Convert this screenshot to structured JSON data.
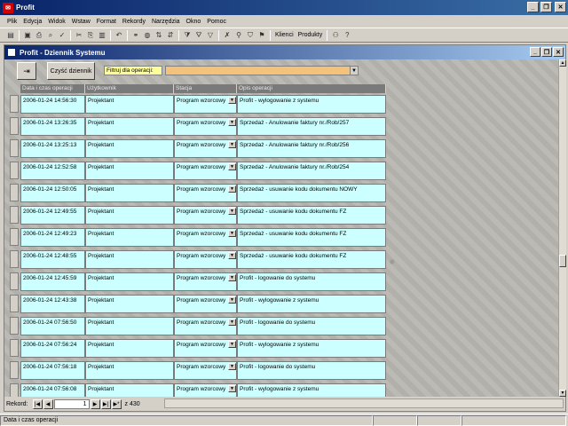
{
  "app": {
    "title": "Profit"
  },
  "menu": [
    "Plik",
    "Edycja",
    "Widok",
    "Wstaw",
    "Format",
    "Rekordy",
    "Narzędzia",
    "Okno",
    "Pomoc"
  ],
  "toolbar": {
    "clients_label": "Klienci",
    "products_label": "Produkty"
  },
  "window": {
    "title": "Profit - Dziennik Systemu"
  },
  "form": {
    "clear_button": "Czyść dziennik",
    "filter_label": "Filtruj dla operacji:",
    "filter_value": ""
  },
  "columns": [
    "Data i czas operacji",
    "Użytkownik",
    "Stacja",
    "Opis operacji"
  ],
  "rows": [
    {
      "date": "2006-01-24 14:56:30",
      "user": "Projektant",
      "station": "Program wzorcowy",
      "desc": "Profit - wylogowanie z systemu"
    },
    {
      "date": "2006-01-24 13:26:35",
      "user": "Projektant",
      "station": "Program wzorcowy",
      "desc": "Sprzedaż - Anulowanie faktury nr./Rob/257"
    },
    {
      "date": "2006-01-24 13:25:13",
      "user": "Projektant",
      "station": "Program wzorcowy",
      "desc": "Sprzedaż - Anulowanie faktury nr./Rob/256"
    },
    {
      "date": "2006-01-24 12:52:58",
      "user": "Projektant",
      "station": "Program wzorcowy",
      "desc": "Sprzedaż - Anulowanie faktury nr./Rob/254"
    },
    {
      "date": "2006-01-24 12:50:05",
      "user": "Projektant",
      "station": "Program wzorcowy",
      "desc": "Sprzedaż - usuwanie kodu dokumentu NOWY"
    },
    {
      "date": "2006-01-24 12:49:55",
      "user": "Projektant",
      "station": "Program wzorcowy",
      "desc": "Sprzedaż - usuwanie kodu dokumentu FZ"
    },
    {
      "date": "2006-01-24 12:49:23",
      "user": "Projektant",
      "station": "Program wzorcowy",
      "desc": "Sprzedaż - usuwanie kodu dokumentu FZ"
    },
    {
      "date": "2006-01-24 12:48:55",
      "user": "Projektant",
      "station": "Program wzorcowy",
      "desc": "Sprzedaż - usuwanie kodu dokumentu FZ"
    },
    {
      "date": "2006-01-24 12:45:59",
      "user": "Projektant",
      "station": "Program wzorcowy",
      "desc": "Profit - logowanie do systemu"
    },
    {
      "date": "2006-01-24 12:43:38",
      "user": "Projektant",
      "station": "Program wzorcowy",
      "desc": "Profit - wylogowanie z systemu"
    },
    {
      "date": "2006-01-24 07:56:50",
      "user": "Projektant",
      "station": "Program wzorcowy",
      "desc": "Profit - logowanie do systemu"
    },
    {
      "date": "2006-01-24 07:56:24",
      "user": "Projektant",
      "station": "Program wzorcowy",
      "desc": "Profit - wylogowanie z systemu"
    },
    {
      "date": "2006-01-24 07:56:18",
      "user": "Projektant",
      "station": "Program wzorcowy",
      "desc": "Profit - logowanie do systemu"
    },
    {
      "date": "2006-01-24 07:56:08",
      "user": "Projektant",
      "station": "Program wzorcowy",
      "desc": "Profit - wylogowanie z systemu"
    }
  ],
  "nav": {
    "label": "Rekord:",
    "current": "1",
    "total": "z 430"
  },
  "status": {
    "text": "Data i czas operacji"
  }
}
